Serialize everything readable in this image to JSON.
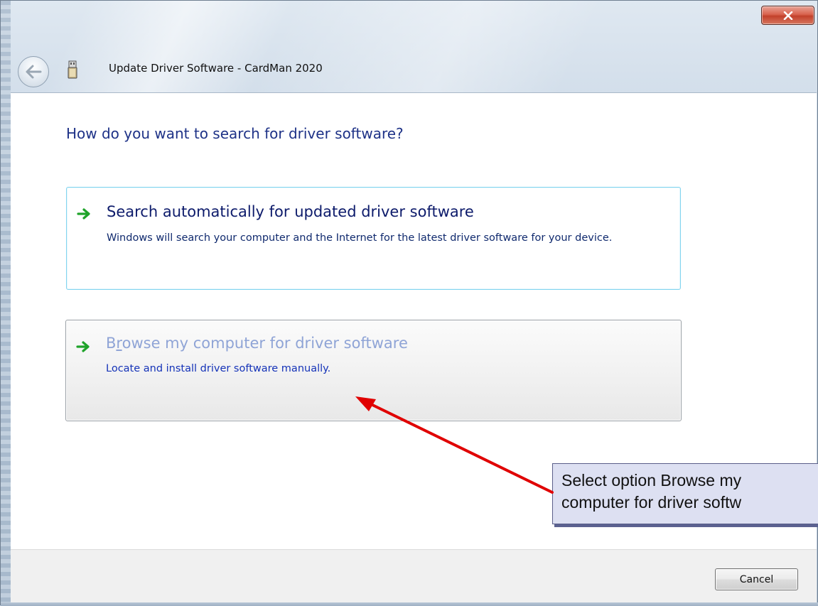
{
  "window": {
    "title": "Update Driver Software - CardMan 2020",
    "close_icon": "close-x-icon",
    "back_icon": "back-arrow-icon",
    "device_icon": "usb-device-icon"
  },
  "main": {
    "heading": "How do you want to search for driver software?",
    "options": [
      {
        "title": "Search automatically for updated driver software",
        "description": "Windows will search your computer and the Internet for the latest driver software for your device.",
        "icon": "green-arrow-icon",
        "state": "normal"
      },
      {
        "title_prefix": "B",
        "title_accesskey": "r",
        "title_rest": "owse my computer for driver software",
        "description": "Locate and install driver software manually.",
        "icon": "green-arrow-icon",
        "state": "hover"
      }
    ]
  },
  "footer": {
    "cancel_label": "Cancel"
  },
  "annotation": {
    "line1": "Select option Browse my",
    "line2": "computer for driver softw",
    "arrow_color": "#e00000"
  },
  "colors": {
    "heading": "#1e3287",
    "hover_title": "#8fa4d6",
    "link_blue": "#1533b8",
    "option_border_active": "#82d4ee"
  }
}
